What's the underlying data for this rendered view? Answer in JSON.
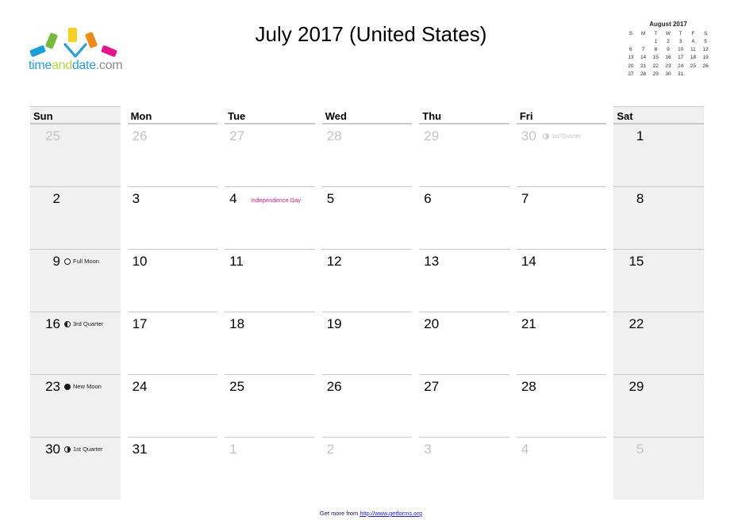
{
  "brand": {
    "name_time": "time",
    "name_and": "and",
    "name_date": "date",
    "name_com": ".com",
    "colors": {
      "blue": "#2b9ed6",
      "green": "#b7d84a",
      "ray_blue": "#1a9fd9",
      "ray_green": "#7ab83e",
      "ray_yellow": "#f5d222",
      "ray_orange": "#f08a1c",
      "ray_pink": "#e2188a"
    }
  },
  "header": {
    "title": "July 2017 (United States)"
  },
  "mini_calendar": {
    "title": "August 2017",
    "weekday_headers": [
      "S",
      "M",
      "T",
      "W",
      "T",
      "F",
      "S"
    ],
    "weeks": [
      [
        "",
        "",
        "1",
        "2",
        "3",
        "4",
        "5"
      ],
      [
        "6",
        "7",
        "8",
        "9",
        "10",
        "11",
        "12"
      ],
      [
        "13",
        "14",
        "15",
        "16",
        "17",
        "18",
        "19"
      ],
      [
        "20",
        "21",
        "22",
        "23",
        "24",
        "25",
        "26"
      ],
      [
        "27",
        "28",
        "29",
        "30",
        "31",
        "",
        ""
      ]
    ]
  },
  "calendar": {
    "weekday_headers": [
      "Sun",
      "Mon",
      "Tue",
      "Wed",
      "Thu",
      "Fri",
      "Sat"
    ],
    "event_color": "#e6198c",
    "weeks": [
      [
        {
          "num": "25",
          "out": true
        },
        {
          "num": "26",
          "out": true
        },
        {
          "num": "27",
          "out": true
        },
        {
          "num": "28",
          "out": true
        },
        {
          "num": "29",
          "out": true
        },
        {
          "num": "30",
          "out": true,
          "moon": "1st Quarter",
          "moon_phase": "first"
        },
        {
          "num": "1"
        }
      ],
      [
        {
          "num": "2"
        },
        {
          "num": "3"
        },
        {
          "num": "4",
          "event": "Independence Day"
        },
        {
          "num": "5"
        },
        {
          "num": "6"
        },
        {
          "num": "7"
        },
        {
          "num": "8"
        }
      ],
      [
        {
          "num": "9",
          "moon": "Full Moon",
          "moon_phase": "full"
        },
        {
          "num": "10"
        },
        {
          "num": "11"
        },
        {
          "num": "12"
        },
        {
          "num": "13"
        },
        {
          "num": "14"
        },
        {
          "num": "15"
        }
      ],
      [
        {
          "num": "16",
          "moon": "3rd Quarter",
          "moon_phase": "third"
        },
        {
          "num": "17"
        },
        {
          "num": "18"
        },
        {
          "num": "19"
        },
        {
          "num": "20"
        },
        {
          "num": "21"
        },
        {
          "num": "22"
        }
      ],
      [
        {
          "num": "23",
          "moon": "New Moon",
          "moon_phase": "new"
        },
        {
          "num": "24"
        },
        {
          "num": "25"
        },
        {
          "num": "26"
        },
        {
          "num": "27"
        },
        {
          "num": "28"
        },
        {
          "num": "29"
        }
      ],
      [
        {
          "num": "30",
          "moon": "1st Quarter",
          "moon_phase": "first"
        },
        {
          "num": "31"
        },
        {
          "num": "1",
          "out": true
        },
        {
          "num": "2",
          "out": true
        },
        {
          "num": "3",
          "out": true
        },
        {
          "num": "4",
          "out": true
        },
        {
          "num": "5",
          "out": true
        }
      ]
    ]
  },
  "footer": {
    "prefix": "Get more from ",
    "url": "http://www.getforms.org"
  }
}
